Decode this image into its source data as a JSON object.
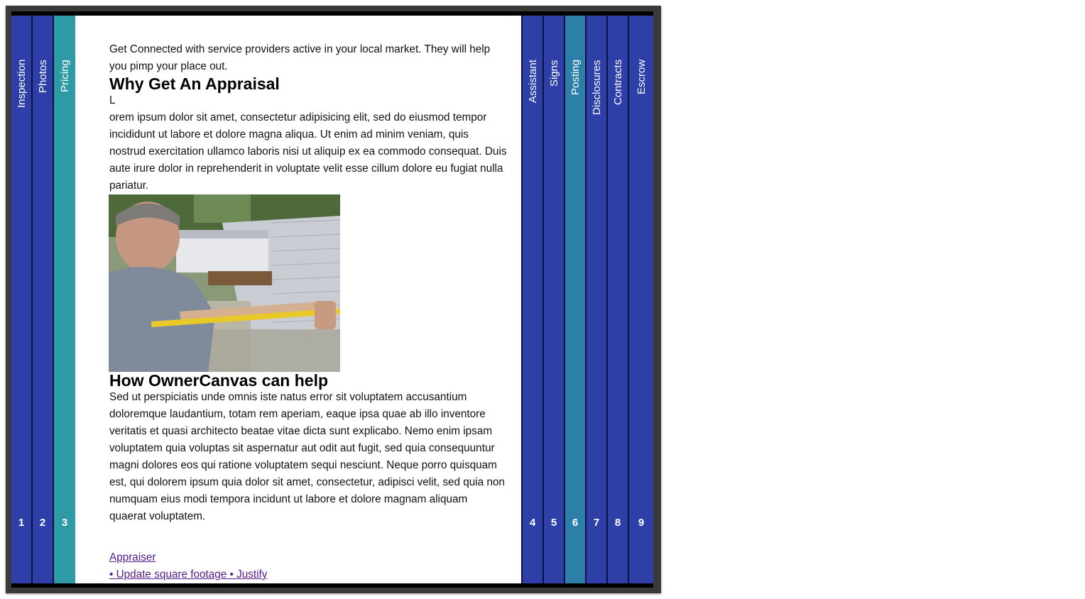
{
  "tabs_left": [
    {
      "label": "Inspection",
      "num": "1",
      "color": "#2e3fa8"
    },
    {
      "label": "Photos",
      "num": "2",
      "color": "#2e3fa8"
    },
    {
      "label": "Pricing",
      "num": "3",
      "color": "#2d9aa6"
    }
  ],
  "tabs_right": [
    {
      "label": "Assistant",
      "num": "4",
      "color": "#2e3fa8"
    },
    {
      "label": "Signs",
      "num": "5",
      "color": "#2e3fa8"
    },
    {
      "label": "Posting",
      "num": "6",
      "color": "#2b7fa8"
    },
    {
      "label": "Disclosures",
      "num": "7",
      "color": "#2e3fa8"
    },
    {
      "label": "Contracts",
      "num": "8",
      "color": "#2e3fa8"
    },
    {
      "label": "Escrow",
      "num": "9",
      "color": "#2e3fa8"
    }
  ],
  "content": {
    "intro": "Get Connected with service providers active in your local market. They will help you pimp your place out.",
    "heading1": "Why Get An Appraisal",
    "dropcap": "L",
    "para1": "orem ipsum dolor sit amet, consectetur adipisicing elit, sed do eiusmod tempor incididunt ut labore et dolore magna aliqua. Ut enim ad minim veniam, quis nostrud exercitation ullamco laboris nisi ut aliquip ex ea commodo consequat. Duis aute irure dolor in reprehenderit in voluptate velit esse cillum dolore eu fugiat nulla pariatur.",
    "heading2": "How OwnerCanvas can help",
    "para2": "Sed ut perspiciatis unde omnis iste natus error sit voluptatem accusantium doloremque laudantium, totam rem aperiam, eaque ipsa quae ab illo inventore veritatis et quasi architecto beatae vitae dicta sunt explicabo. Nemo enim ipsam voluptatem quia voluptas sit aspernatur aut odit aut fugit, sed quia consequuntur magni dolores eos qui ratione voluptatem sequi nesciunt. Neque porro quisquam est, qui dolorem ipsum quia dolor sit amet, consectetur, adipisci velit, sed quia non numquam eius modi tempora incidunt ut labore et dolore magnam aliquam quaerat voluptatem.",
    "link1": "Appraiser",
    "link2": "• Update square footage • Justify"
  }
}
